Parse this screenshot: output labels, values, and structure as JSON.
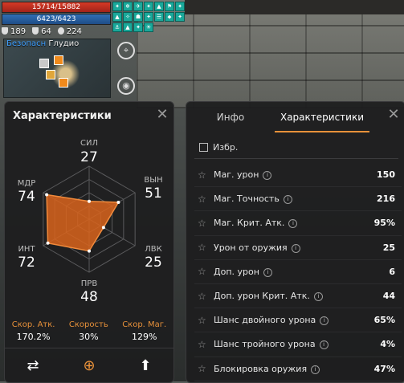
{
  "hud": {
    "hp": "15714/15882",
    "mp": "6423/6423",
    "counts": [
      "189",
      "64",
      "224"
    ],
    "buffs": [
      "✦",
      "❄",
      "✈",
      "✦",
      "▲",
      "⚑",
      "✦",
      "▲",
      "✧",
      "☗",
      "✦",
      "☰",
      "⬥",
      "✦",
      "⚓",
      "▲",
      "✦",
      "☀"
    ]
  },
  "minimap": {
    "safe": "Безопасн",
    "zone": "Глудио"
  },
  "left_panel": {
    "title": "Характеристики",
    "stats": {
      "str": {
        "label": "СИЛ",
        "value": "27"
      },
      "con": {
        "label": "ВЫН",
        "value": "51"
      },
      "dex": {
        "label": "ЛВК",
        "value": "25"
      },
      "wit": {
        "label": "ПРВ",
        "value": "48"
      },
      "int": {
        "label": "ИНТ",
        "value": "72"
      },
      "men": {
        "label": "МДР",
        "value": "74"
      }
    },
    "speeds": [
      {
        "label": "Скор. Атк.",
        "value": "170.2%"
      },
      {
        "label": "Скорость",
        "value": "30%"
      },
      {
        "label": "Скор. Маг.",
        "value": "129%"
      }
    ],
    "buttons": [
      "⇄",
      "⊕",
      "⬆"
    ]
  },
  "right_panel": {
    "tabs": [
      "Инфо",
      "Характеристики"
    ],
    "favorites": "Избр.",
    "rows": [
      {
        "name": "Маг. урон",
        "value": "150"
      },
      {
        "name": "Маг. Точность",
        "value": "216"
      },
      {
        "name": "Маг. Крит. Атк.",
        "value": "95%"
      },
      {
        "name": "Урон от оружия",
        "value": "25"
      },
      {
        "name": "Доп. урон",
        "value": "6"
      },
      {
        "name": "Доп. урон Крит. Атк.",
        "value": "44"
      },
      {
        "name": "Шанс двойного урона",
        "value": "65%"
      },
      {
        "name": "Шанс тройного урона",
        "value": "4%"
      },
      {
        "name": "Блокировка оружия",
        "value": "47%"
      }
    ]
  }
}
